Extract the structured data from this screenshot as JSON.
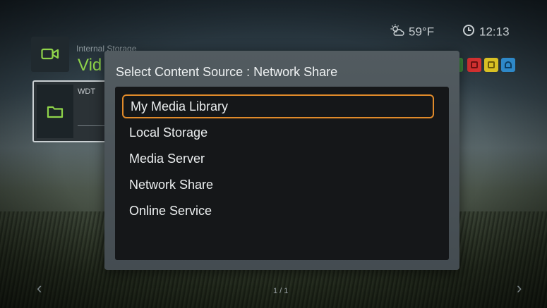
{
  "status": {
    "temperature": "59°F",
    "time": "12:13",
    "weather_icon": "cloud-sun-icon",
    "clock_icon": "clock-icon"
  },
  "background": {
    "storage_label": "Internal Storage",
    "section_title": "Vid",
    "folder_name": "WDT",
    "page_indicator": "1 / 1",
    "nav_left": "‹",
    "nav_right": "›"
  },
  "dialog": {
    "title": "Select Content Source : Network Share",
    "items": [
      {
        "label": "My Media Library",
        "selected": true
      },
      {
        "label": "Local Storage"
      },
      {
        "label": "Media Server"
      },
      {
        "label": "Network Share"
      },
      {
        "label": "Online Service"
      }
    ]
  },
  "colors": {
    "accent_green": "#8fd44a",
    "selection_orange": "#e08a2a",
    "btn_green": "#3c8a3c",
    "btn_red": "#d13030",
    "btn_yellow": "#d8c024",
    "btn_blue": "#2e88c8"
  }
}
